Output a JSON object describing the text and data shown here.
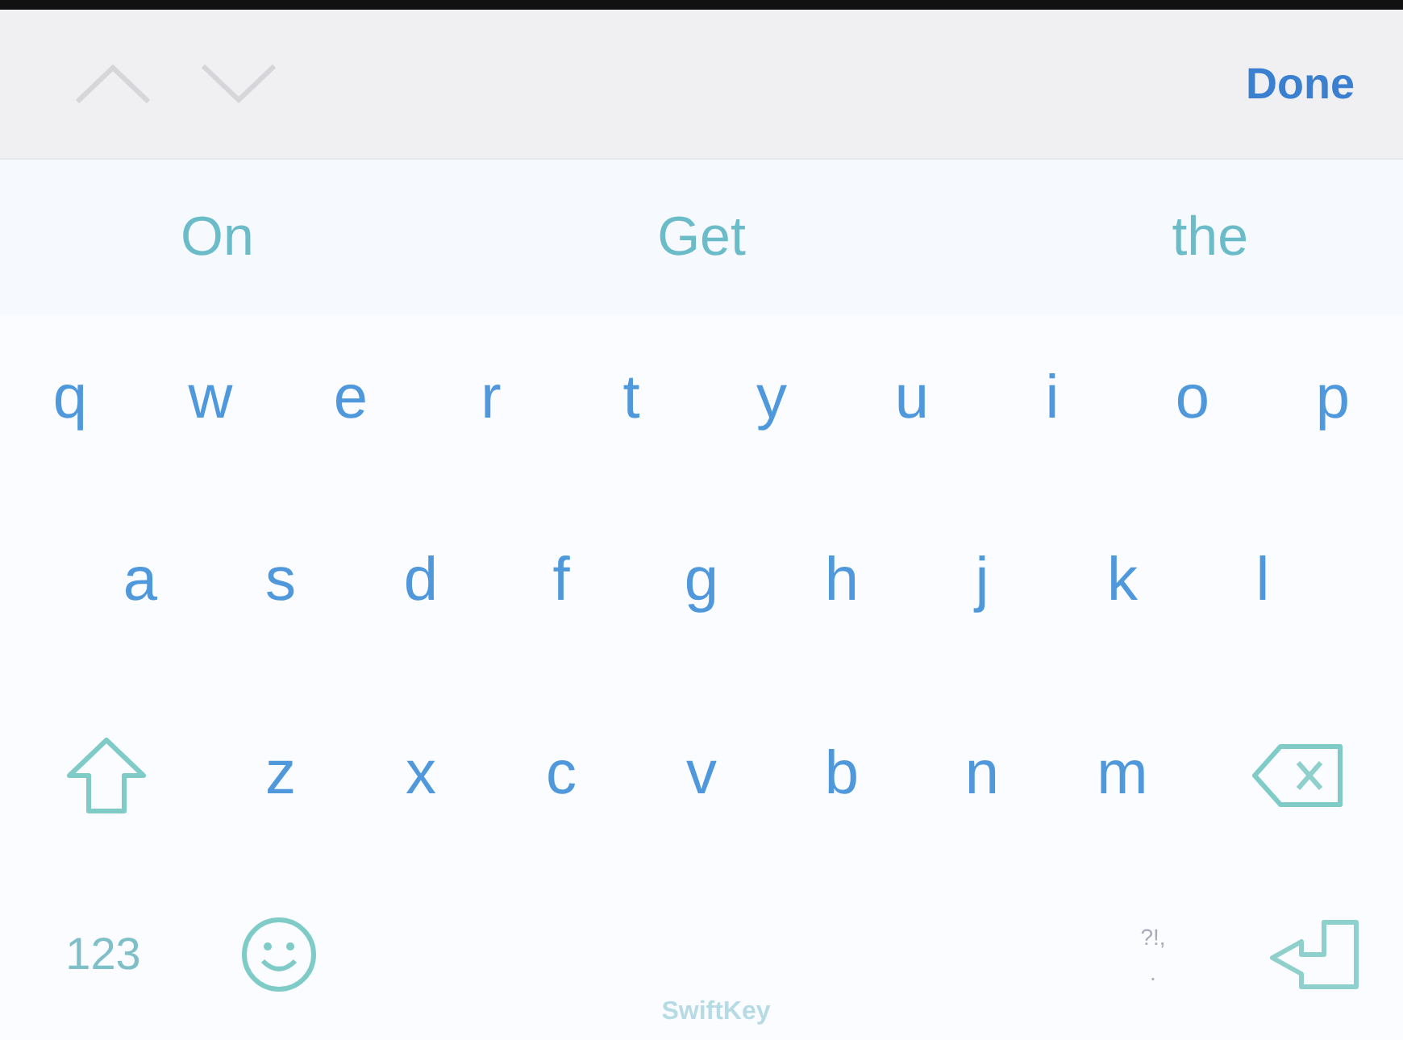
{
  "toolbar": {
    "done": "Done"
  },
  "suggestions": [
    "On",
    "Get",
    "the"
  ],
  "rows": [
    {
      "keys": [
        {
          "kind": "letter",
          "label": "q"
        },
        {
          "kind": "letter",
          "label": "w"
        },
        {
          "kind": "letter",
          "label": "e"
        },
        {
          "kind": "letter",
          "label": "r"
        },
        {
          "kind": "letter",
          "label": "t"
        },
        {
          "kind": "letter",
          "label": "y"
        },
        {
          "kind": "letter",
          "label": "u"
        },
        {
          "kind": "letter",
          "label": "i"
        },
        {
          "kind": "letter",
          "label": "o"
        },
        {
          "kind": "letter",
          "label": "p"
        }
      ]
    },
    {
      "keys": [
        {
          "kind": "letter",
          "label": "a"
        },
        {
          "kind": "letter",
          "label": "s"
        },
        {
          "kind": "letter",
          "label": "d"
        },
        {
          "kind": "letter",
          "label": "f"
        },
        {
          "kind": "letter",
          "label": "g"
        },
        {
          "kind": "letter",
          "label": "h"
        },
        {
          "kind": "letter",
          "label": "j"
        },
        {
          "kind": "letter",
          "label": "k"
        },
        {
          "kind": "letter",
          "label": "l"
        }
      ]
    },
    {
      "keys": [
        {
          "kind": "shift"
        },
        {
          "kind": "letter",
          "label": "z"
        },
        {
          "kind": "letter",
          "label": "x"
        },
        {
          "kind": "letter",
          "label": "c"
        },
        {
          "kind": "letter",
          "label": "v"
        },
        {
          "kind": "letter",
          "label": "b"
        },
        {
          "kind": "letter",
          "label": "n"
        },
        {
          "kind": "letter",
          "label": "m"
        },
        {
          "kind": "delete"
        }
      ]
    },
    {
      "keys": [
        {
          "kind": "numbers",
          "label": "123"
        },
        {
          "kind": "emoji"
        },
        {
          "kind": "space",
          "label": "SwiftKey"
        },
        {
          "kind": "punctuation",
          "label": "?!,",
          "sublabel": "."
        },
        {
          "kind": "return"
        }
      ]
    }
  ]
}
